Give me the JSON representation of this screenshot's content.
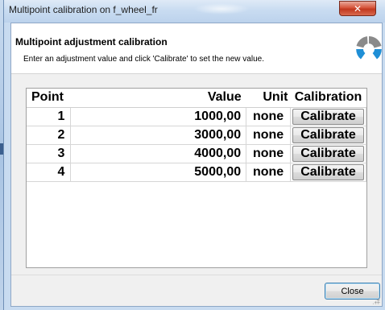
{
  "window": {
    "title": "Multipoint calibration on f_wheel_fr",
    "close_glyph": "✕"
  },
  "header": {
    "title": "Multipoint adjustment calibration",
    "subtitle": "Enter an adjustment value and click 'Calibrate' to set the new value."
  },
  "table": {
    "columns": [
      "Point",
      "Value",
      "Unit",
      "Calibration"
    ],
    "rows": [
      {
        "point": "1",
        "value": "1000,00",
        "unit": "none",
        "action": "Calibrate"
      },
      {
        "point": "2",
        "value": "3000,00",
        "unit": "none",
        "action": "Calibrate"
      },
      {
        "point": "3",
        "value": "4000,00",
        "unit": "none",
        "action": "Calibrate"
      },
      {
        "point": "4",
        "value": "5000,00",
        "unit": "none",
        "action": "Calibrate"
      }
    ]
  },
  "footer": {
    "close_label": "Close"
  },
  "logo": {
    "icon": "segmented-ring-logo",
    "colors": [
      "#1f8fd6",
      "#8a8a8a"
    ]
  }
}
